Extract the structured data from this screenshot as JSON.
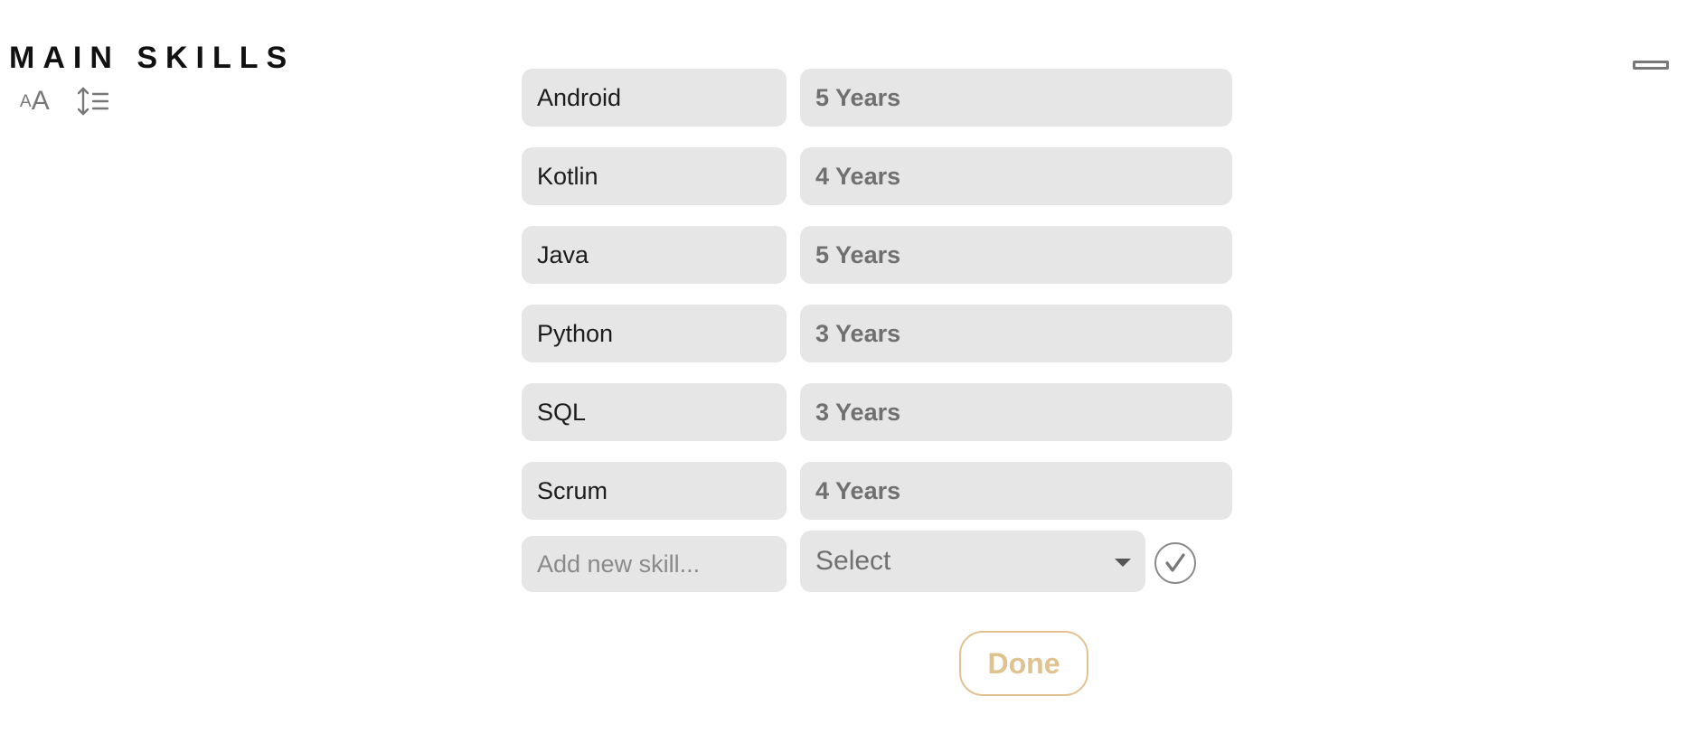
{
  "header": {
    "title": "MAIN SKILLS",
    "font_size_icon_small": "A",
    "font_size_icon_large": "A"
  },
  "skills": [
    {
      "name": "Android",
      "experience": "5 Years"
    },
    {
      "name": "Kotlin",
      "experience": "4 Years"
    },
    {
      "name": "Java",
      "experience": "5 Years"
    },
    {
      "name": "Python",
      "experience": "3 Years"
    },
    {
      "name": "SQL",
      "experience": "3 Years"
    },
    {
      "name": "Scrum",
      "experience": "4 Years"
    }
  ],
  "new_skill": {
    "placeholder": "Add new skill...",
    "experience_select_value": "Select"
  },
  "actions": {
    "done_label": "Done"
  },
  "colors": {
    "field_bg": "#e6e6e6",
    "done_accent": "#e2c293",
    "muted_text": "#707070"
  }
}
